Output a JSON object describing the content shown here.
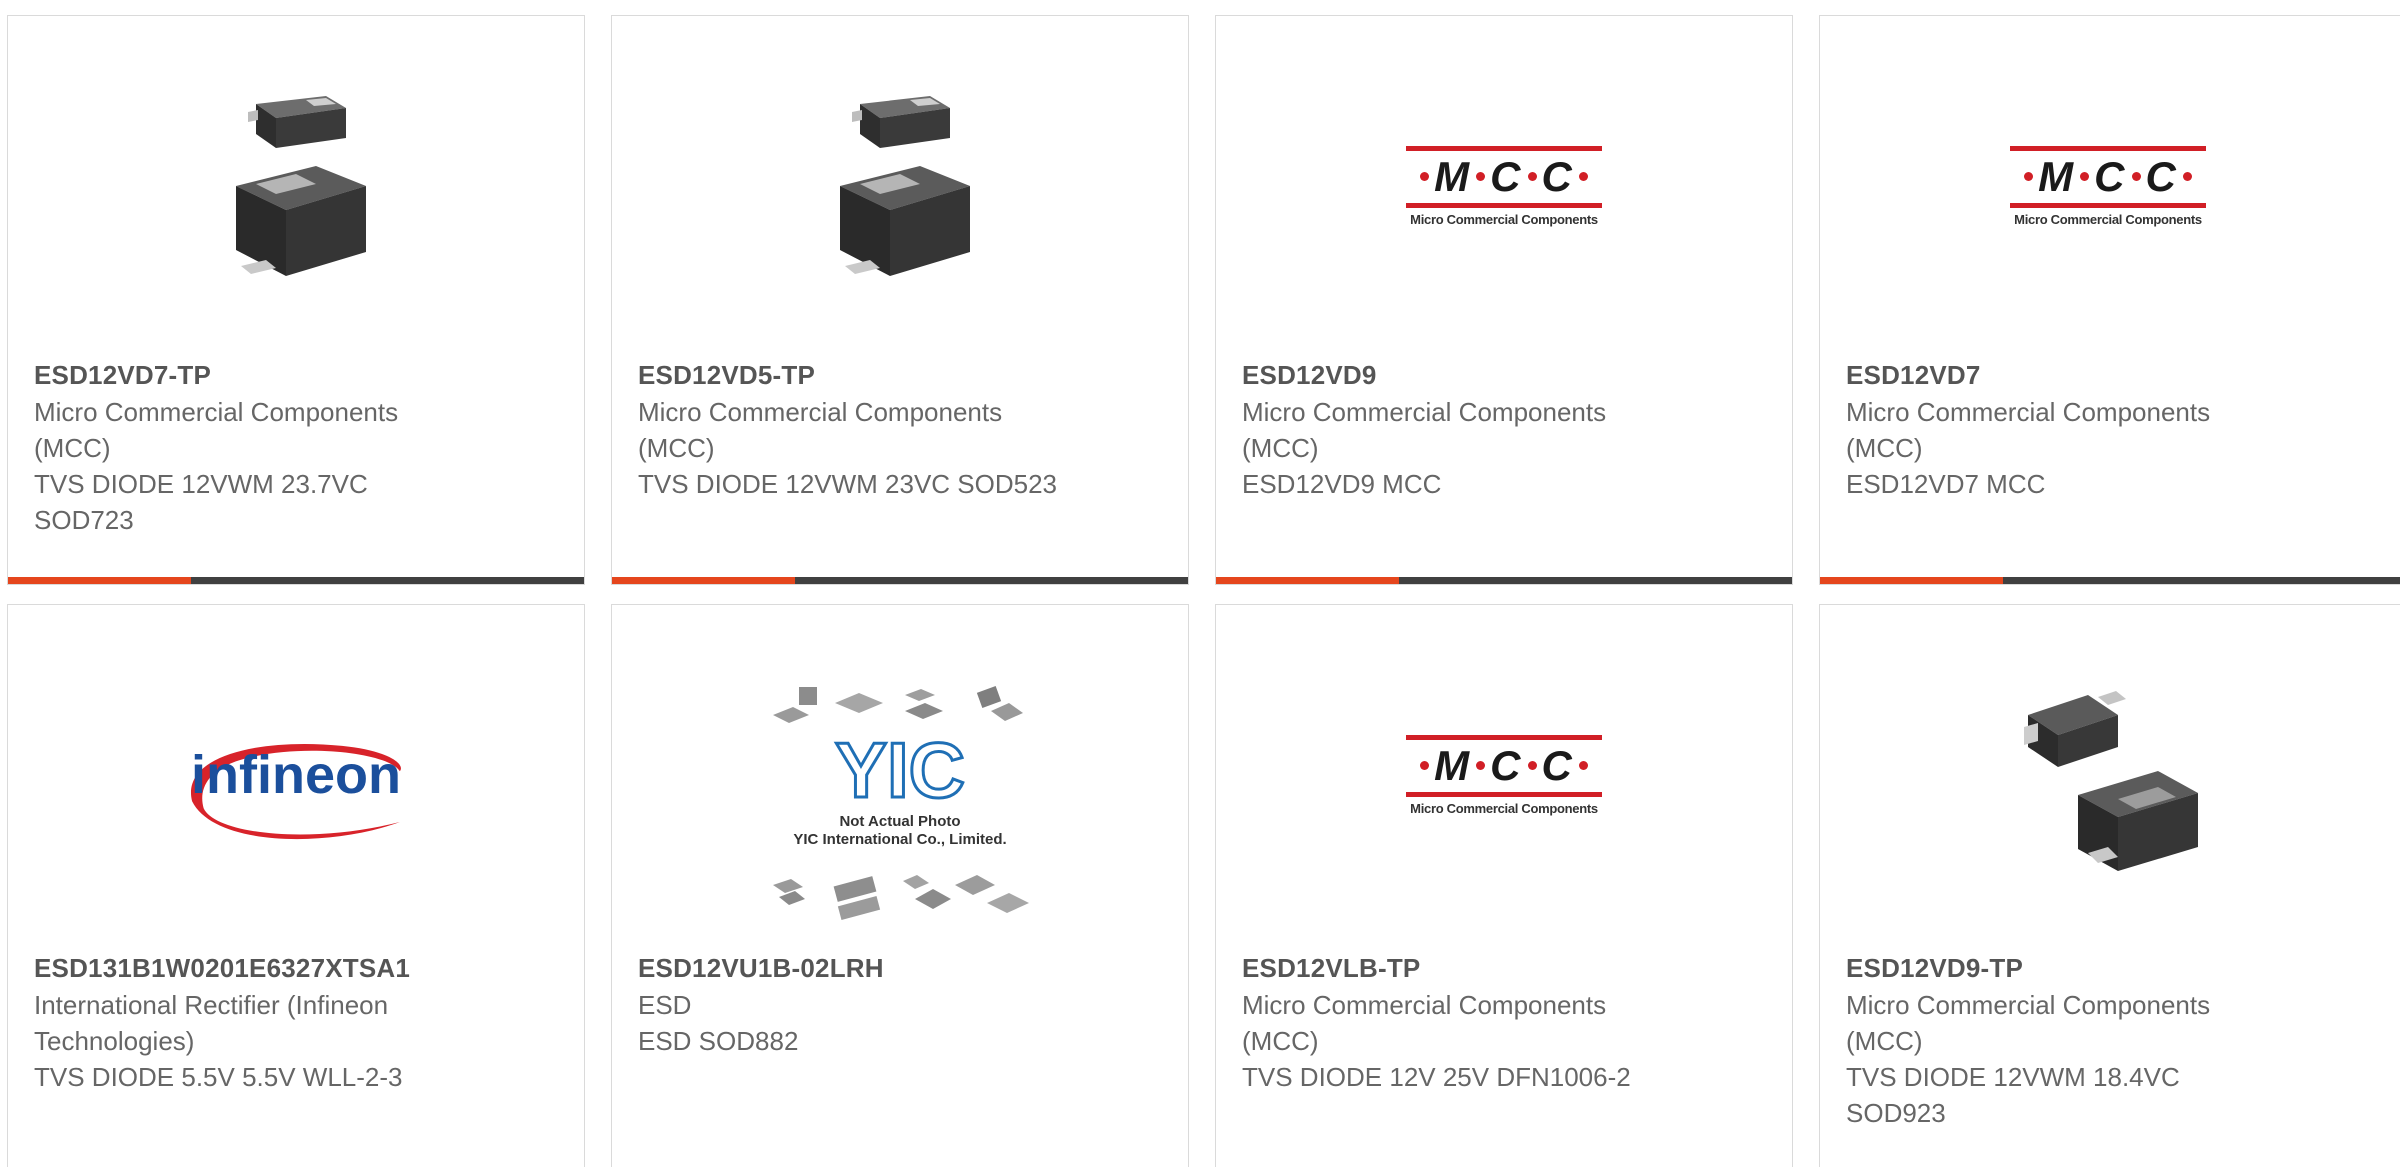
{
  "products": [
    {
      "part_number": "ESD12VD7-TP",
      "manufacturer": "Micro Commercial Components (MCC)",
      "description": "TVS DIODE 12VWM 23.7VC SOD723",
      "image": "sod-package-photo"
    },
    {
      "part_number": "ESD12VD5-TP",
      "manufacturer": "Micro Commercial Components (MCC)",
      "description": "TVS DIODE 12VWM 23VC SOD523",
      "image": "sod-package-photo"
    },
    {
      "part_number": "ESD12VD9",
      "manufacturer": "Micro Commercial Components (MCC)",
      "description": "ESD12VD9 MCC",
      "image": "mcc-logo"
    },
    {
      "part_number": "ESD12VD7",
      "manufacturer": "Micro Commercial Components (MCC)",
      "description": "ESD12VD7 MCC",
      "image": "mcc-logo"
    },
    {
      "part_number": "ESD131B1W0201E6327XTSA1",
      "manufacturer": "International Rectifier (Infineon Technologies)",
      "description": "TVS DIODE 5.5V 5.5V WLL-2-3",
      "image": "infineon-logo"
    },
    {
      "part_number": "ESD12VU1B-02LRH",
      "manufacturer": "ESD",
      "description": "ESD SOD882",
      "image": "yic-placeholder"
    },
    {
      "part_number": "ESD12VLB-TP",
      "manufacturer": "Micro Commercial Components (MCC)",
      "description": "TVS DIODE 12V 25V DFN1006-2",
      "image": "mcc-logo"
    },
    {
      "part_number": "ESD12VD9-TP",
      "manufacturer": "Micro Commercial Components (MCC)",
      "description": "TVS DIODE 12VWM 18.4VC SOD923",
      "image": "sod-package-photo"
    }
  ],
  "logos": {
    "mcc_letters": [
      "M",
      "C",
      "C"
    ],
    "mcc_subtitle": "Micro Commercial Components",
    "infineon_text": "infineon",
    "yic_mark": "YIC",
    "yic_caption_line1": "Not Actual Photo",
    "yic_caption_line2": "YIC International Co., Limited."
  },
  "colors": {
    "accent": "#e5461d",
    "bar": "#404040",
    "part_number": "#555555",
    "body_text": "#666666",
    "mcc_red": "#d11f26",
    "infineon_blue": "#1b4f9c"
  }
}
